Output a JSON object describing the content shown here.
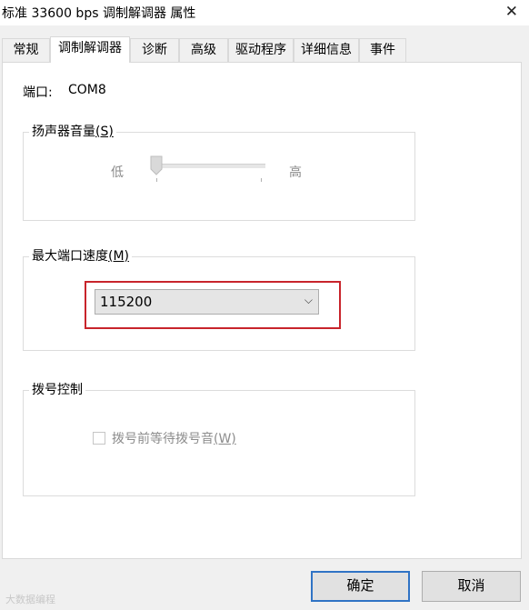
{
  "window": {
    "title": "标准 33600 bps 调制解调器 属性",
    "close_glyph": "✕"
  },
  "tabs": [
    {
      "label": "常规",
      "active": false
    },
    {
      "label": "调制解调器",
      "active": true
    },
    {
      "label": "诊断",
      "active": false
    },
    {
      "label": "高级",
      "active": false
    },
    {
      "label": "驱动程序",
      "active": false
    },
    {
      "label": "详细信息",
      "active": false
    },
    {
      "label": "事件",
      "active": false
    }
  ],
  "port": {
    "label": "端口:",
    "value": "COM8"
  },
  "speaker": {
    "title": "扬声器音量",
    "accel": "(S)",
    "low_label": "低",
    "high_label": "高",
    "level": 0
  },
  "max_speed": {
    "title": "最大端口速度",
    "accel": "(M)",
    "selected": "115200",
    "highlight_color": "#c8242b"
  },
  "dial_control": {
    "title": "拨号控制",
    "checkbox_label": "拨号前等待拨号音",
    "checkbox_accel": "(W)",
    "checked": false,
    "enabled": false
  },
  "buttons": {
    "ok": "确定",
    "cancel": "取消"
  },
  "watermark": "大数据编程"
}
